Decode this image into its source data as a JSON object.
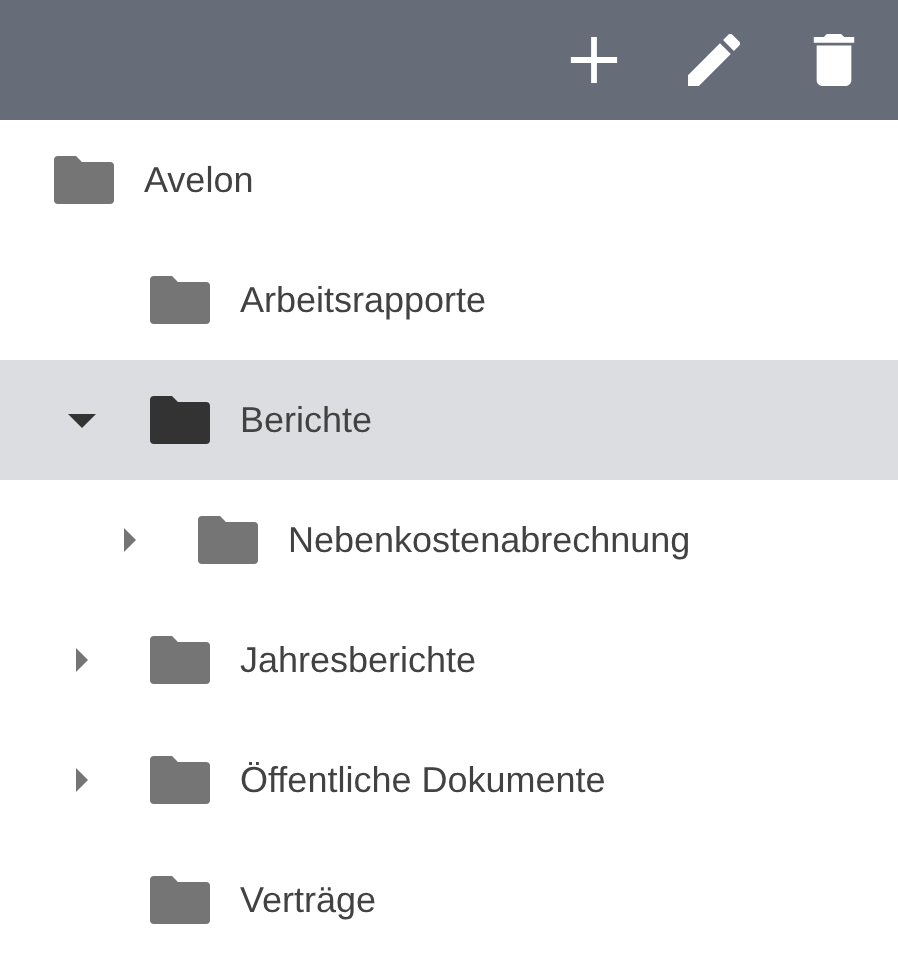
{
  "toolbar": {
    "actions": [
      {
        "kind": "add"
      },
      {
        "kind": "edit"
      },
      {
        "kind": "delete"
      }
    ]
  },
  "tree": [
    {
      "label": "Avelon",
      "expandable": false,
      "selected": false,
      "children": [
        {
          "label": "Arbeitsrapporte",
          "expandable": false,
          "selected": false
        },
        {
          "label": "Berichte",
          "expandable": true,
          "expanded": true,
          "selected": true,
          "children": [
            {
              "label": "Nebenkostenabrechnung",
              "expandable": true,
              "expanded": false,
              "selected": false
            }
          ]
        },
        {
          "label": "Jahresberichte",
          "expandable": true,
          "expanded": false,
          "selected": false
        },
        {
          "label": "Öffentliche Dokumente",
          "expandable": true,
          "expanded": false,
          "selected": false
        },
        {
          "label": "Verträge",
          "expandable": false,
          "selected": false
        }
      ]
    }
  ]
}
